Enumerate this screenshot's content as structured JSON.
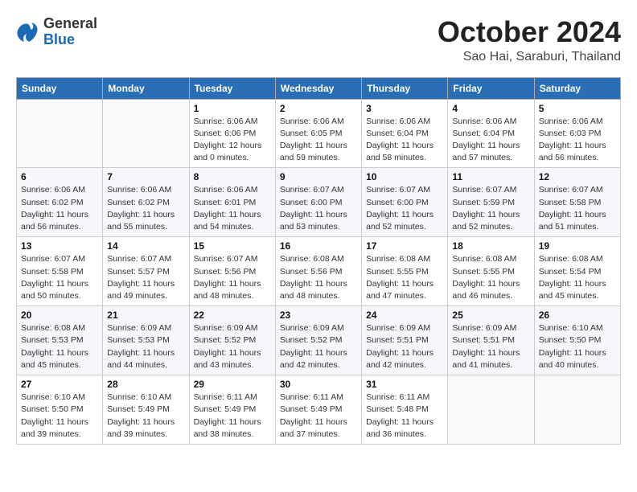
{
  "header": {
    "logo_general": "General",
    "logo_blue": "Blue",
    "month": "October 2024",
    "location": "Sao Hai, Saraburi, Thailand"
  },
  "weekdays": [
    "Sunday",
    "Monday",
    "Tuesday",
    "Wednesday",
    "Thursday",
    "Friday",
    "Saturday"
  ],
  "weeks": [
    [
      {
        "day": "",
        "info": ""
      },
      {
        "day": "",
        "info": ""
      },
      {
        "day": "1",
        "info": "Sunrise: 6:06 AM\nSunset: 6:06 PM\nDaylight: 12 hours\nand 0 minutes."
      },
      {
        "day": "2",
        "info": "Sunrise: 6:06 AM\nSunset: 6:05 PM\nDaylight: 11 hours\nand 59 minutes."
      },
      {
        "day": "3",
        "info": "Sunrise: 6:06 AM\nSunset: 6:04 PM\nDaylight: 11 hours\nand 58 minutes."
      },
      {
        "day": "4",
        "info": "Sunrise: 6:06 AM\nSunset: 6:04 PM\nDaylight: 11 hours\nand 57 minutes."
      },
      {
        "day": "5",
        "info": "Sunrise: 6:06 AM\nSunset: 6:03 PM\nDaylight: 11 hours\nand 56 minutes."
      }
    ],
    [
      {
        "day": "6",
        "info": "Sunrise: 6:06 AM\nSunset: 6:02 PM\nDaylight: 11 hours\nand 56 minutes."
      },
      {
        "day": "7",
        "info": "Sunrise: 6:06 AM\nSunset: 6:02 PM\nDaylight: 11 hours\nand 55 minutes."
      },
      {
        "day": "8",
        "info": "Sunrise: 6:06 AM\nSunset: 6:01 PM\nDaylight: 11 hours\nand 54 minutes."
      },
      {
        "day": "9",
        "info": "Sunrise: 6:07 AM\nSunset: 6:00 PM\nDaylight: 11 hours\nand 53 minutes."
      },
      {
        "day": "10",
        "info": "Sunrise: 6:07 AM\nSunset: 6:00 PM\nDaylight: 11 hours\nand 52 minutes."
      },
      {
        "day": "11",
        "info": "Sunrise: 6:07 AM\nSunset: 5:59 PM\nDaylight: 11 hours\nand 52 minutes."
      },
      {
        "day": "12",
        "info": "Sunrise: 6:07 AM\nSunset: 5:58 PM\nDaylight: 11 hours\nand 51 minutes."
      }
    ],
    [
      {
        "day": "13",
        "info": "Sunrise: 6:07 AM\nSunset: 5:58 PM\nDaylight: 11 hours\nand 50 minutes."
      },
      {
        "day": "14",
        "info": "Sunrise: 6:07 AM\nSunset: 5:57 PM\nDaylight: 11 hours\nand 49 minutes."
      },
      {
        "day": "15",
        "info": "Sunrise: 6:07 AM\nSunset: 5:56 PM\nDaylight: 11 hours\nand 48 minutes."
      },
      {
        "day": "16",
        "info": "Sunrise: 6:08 AM\nSunset: 5:56 PM\nDaylight: 11 hours\nand 48 minutes."
      },
      {
        "day": "17",
        "info": "Sunrise: 6:08 AM\nSunset: 5:55 PM\nDaylight: 11 hours\nand 47 minutes."
      },
      {
        "day": "18",
        "info": "Sunrise: 6:08 AM\nSunset: 5:55 PM\nDaylight: 11 hours\nand 46 minutes."
      },
      {
        "day": "19",
        "info": "Sunrise: 6:08 AM\nSunset: 5:54 PM\nDaylight: 11 hours\nand 45 minutes."
      }
    ],
    [
      {
        "day": "20",
        "info": "Sunrise: 6:08 AM\nSunset: 5:53 PM\nDaylight: 11 hours\nand 45 minutes."
      },
      {
        "day": "21",
        "info": "Sunrise: 6:09 AM\nSunset: 5:53 PM\nDaylight: 11 hours\nand 44 minutes."
      },
      {
        "day": "22",
        "info": "Sunrise: 6:09 AM\nSunset: 5:52 PM\nDaylight: 11 hours\nand 43 minutes."
      },
      {
        "day": "23",
        "info": "Sunrise: 6:09 AM\nSunset: 5:52 PM\nDaylight: 11 hours\nand 42 minutes."
      },
      {
        "day": "24",
        "info": "Sunrise: 6:09 AM\nSunset: 5:51 PM\nDaylight: 11 hours\nand 42 minutes."
      },
      {
        "day": "25",
        "info": "Sunrise: 6:09 AM\nSunset: 5:51 PM\nDaylight: 11 hours\nand 41 minutes."
      },
      {
        "day": "26",
        "info": "Sunrise: 6:10 AM\nSunset: 5:50 PM\nDaylight: 11 hours\nand 40 minutes."
      }
    ],
    [
      {
        "day": "27",
        "info": "Sunrise: 6:10 AM\nSunset: 5:50 PM\nDaylight: 11 hours\nand 39 minutes."
      },
      {
        "day": "28",
        "info": "Sunrise: 6:10 AM\nSunset: 5:49 PM\nDaylight: 11 hours\nand 39 minutes."
      },
      {
        "day": "29",
        "info": "Sunrise: 6:11 AM\nSunset: 5:49 PM\nDaylight: 11 hours\nand 38 minutes."
      },
      {
        "day": "30",
        "info": "Sunrise: 6:11 AM\nSunset: 5:49 PM\nDaylight: 11 hours\nand 37 minutes."
      },
      {
        "day": "31",
        "info": "Sunrise: 6:11 AM\nSunset: 5:48 PM\nDaylight: 11 hours\nand 36 minutes."
      },
      {
        "day": "",
        "info": ""
      },
      {
        "day": "",
        "info": ""
      }
    ]
  ]
}
